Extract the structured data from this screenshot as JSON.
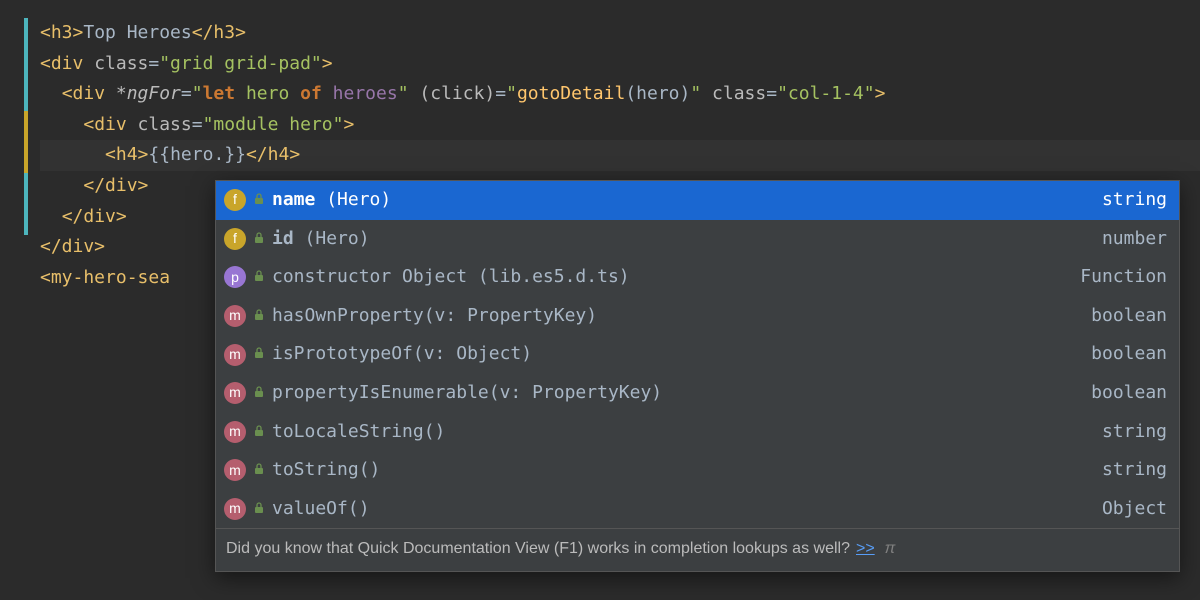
{
  "code": {
    "l1": {
      "tagOpen": "<h3>",
      "text": "Top Heroes",
      "tagClose": "</h3>"
    },
    "l2": {
      "open": "<div ",
      "attr1": "class",
      "val1": "\"grid grid-pad\"",
      "close": ">"
    },
    "l3": {
      "open": "<div ",
      "dir": "*ngFor",
      "dirVal_open": "\"",
      "kw": "let",
      "mid1": " hero ",
      "kw2": "of",
      "sp": " ",
      "var": "heroes",
      "dirVal_close": "\"",
      "sp2": " ",
      "evt": "(click)",
      "eq": "=",
      "evtVal_open": "\"",
      "fn": "gotoDetail",
      "paren": "(",
      "arg": "hero",
      "parenC": ")",
      "evtVal_close": "\"",
      "sp3": " ",
      "attr": "class",
      "attrVal": "\"col-1-4\"",
      "close": ">"
    },
    "l4": {
      "open": "<div ",
      "attr": "class",
      "val": "\"module hero\"",
      "close": ">"
    },
    "l5": {
      "open": "<h4>",
      "exprOpen": "{{",
      "obj": "hero",
      "dot": ".",
      "exprClose": "}}",
      "close": "</h4>"
    },
    "l6": "</div>",
    "l7": "</div>",
    "l8": "</div>",
    "l9": "<my-hero-sea"
  },
  "completion": {
    "items": [
      {
        "kind": "f",
        "label": "name",
        "tail": " (Hero)",
        "type": "string",
        "selected": true
      },
      {
        "kind": "f",
        "label": "id",
        "tail": " (Hero)",
        "type": "number"
      },
      {
        "kind": "p",
        "label": "constructor Object (lib.es5.d.ts)",
        "type": "Function"
      },
      {
        "kind": "m",
        "label": "hasOwnProperty(v: PropertyKey)",
        "type": "boolean"
      },
      {
        "kind": "m",
        "label": "isPrototypeOf(v: Object)",
        "type": "boolean"
      },
      {
        "kind": "m",
        "label": "propertyIsEnumerable(v: PropertyKey)",
        "type": "boolean"
      },
      {
        "kind": "m",
        "label": "toLocaleString()",
        "type": "string"
      },
      {
        "kind": "m",
        "label": "toString()",
        "type": "string"
      },
      {
        "kind": "m",
        "label": "valueOf()",
        "type": "Object"
      }
    ],
    "hint": "Did you know that Quick Documentation View (F1) works in completion lookups as well?",
    "hintLink": ">>",
    "hintPi": "π"
  }
}
